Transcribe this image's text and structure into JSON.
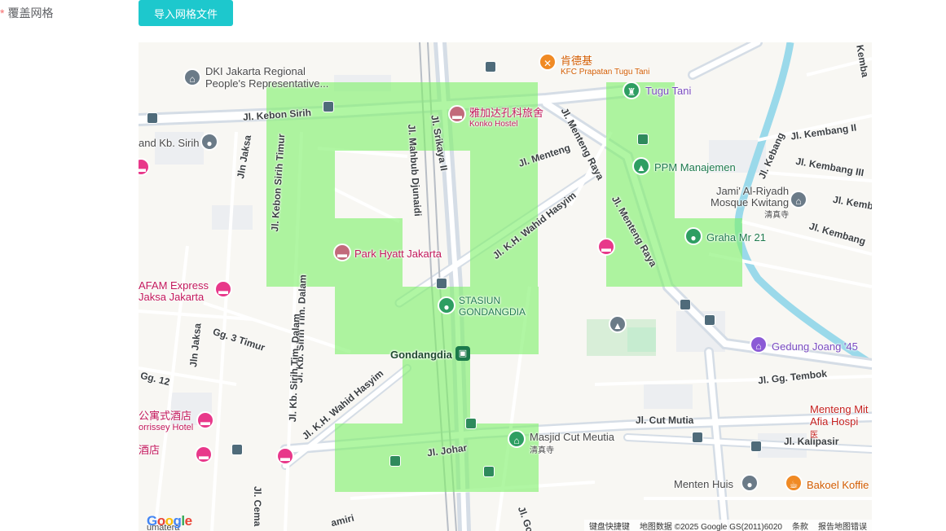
{
  "form": {
    "required_mark": "*",
    "label": "覆盖网格",
    "import_button": "导入网格文件"
  },
  "map": {
    "streets": {
      "kebon_sirih": "Jl. Kebon Sirih",
      "kebon_sirih_timur": "Jl. Kebon Sirih Timur",
      "mahbub": "Jl. Mahbub Djunaidi",
      "srikaya": "Jl. Srikaya II",
      "menteng": "Jl. Menteng",
      "menteng_raya_top": "Jl. Menteng Raya",
      "menteng_raya": "Jl. Menteng Raya",
      "jaksa": "Jln Jaksa",
      "jaksa2": "Jln Jaksa",
      "wahid_hasyim": "Jl. K.H. Wahid Hasyim",
      "wahid_hasyim2": "Jl. K.H. Wahid Hasyim",
      "gg3timur": "Gg. 3 Timur",
      "gg12": "Gg. 12",
      "kb_sirih_tim_dalam": "Jl. Kb. Sirih Tim. Dalam",
      "kb_sirih_tim_dalam2": "Jl. Kb. Sirih Tim. Dalam",
      "johar": "Jl. Johar",
      "cut_mutia": "Jl. Cut Mutia",
      "kalipasir": "Jl. Kalipasir",
      "gg_tembok": "Jl. Gg. Tembok",
      "kembang_ii": "Jl. Kembang II",
      "kembang_iii": "Jl. Kembang III",
      "kembang": "Jl. Kembang",
      "kembang_e": "Jl. Kemb",
      "kembang_top": "Kemba",
      "kebang_v": "Jl. Kebang",
      "cema": "Jl. Cema",
      "gond": "Jl. Gond",
      "amiri": "amiri",
      "umatera": "umatera"
    },
    "pois": {
      "dki_line1": "DKI Jakarta Regional",
      "dki_line2": "People's Representative...",
      "kfc_name": "肯德基",
      "kfc_sub": "KFC Prapatan Tugu Tani",
      "tugu_tani": "Tugu Tani",
      "konko_name": "雅加达孔科旅舍",
      "konko_sub": "Konko Hostel",
      "kb_sirih": "and Kb. Sirih",
      "ppm": "PPM Manajemen",
      "jami_line1": "Jami' Al-Riyadh",
      "jami_line2": "Mosque Kwitang",
      "jami_sub": "清真寺",
      "graha": "Graha Mr 21",
      "park_hyatt": "Park Hyatt Jakarta",
      "afam_line1": "AFAM Express",
      "afam_line2": "Jaksa Jakarta",
      "stasiun_line1": "STASIUN",
      "stasiun_line2": "GONDANGDIA",
      "gondangdia": "Gondangdia",
      "gedung": "Gedung Joang '45",
      "apt_line1": "公寓式酒店",
      "apt_line2": "orrissey Hotel",
      "hotel_cut": "酒店",
      "masjid": "Masjid Cut Meutia",
      "masjid_sub": "清真寺",
      "menteng_mit1": "Menteng Mit",
      "menteng_mit2": "Afia Hospi",
      "menteng_mit3": "医",
      "menten_huis": "Menten Huis",
      "bakoel": "Bakoel Koffie"
    },
    "attribution": {
      "shortcuts": "键盘快捷键",
      "data": "地图数据 ©2025 Google GS(2011)6020",
      "terms": "条款",
      "report": "报告地图错误"
    },
    "logo": "Google"
  },
  "colors": {
    "button": "#1dc8cd",
    "grid_overlay": "#7ff06a",
    "river": "#9ad9ea",
    "road": "#ffffff",
    "major_road": "#cfd9e3"
  }
}
